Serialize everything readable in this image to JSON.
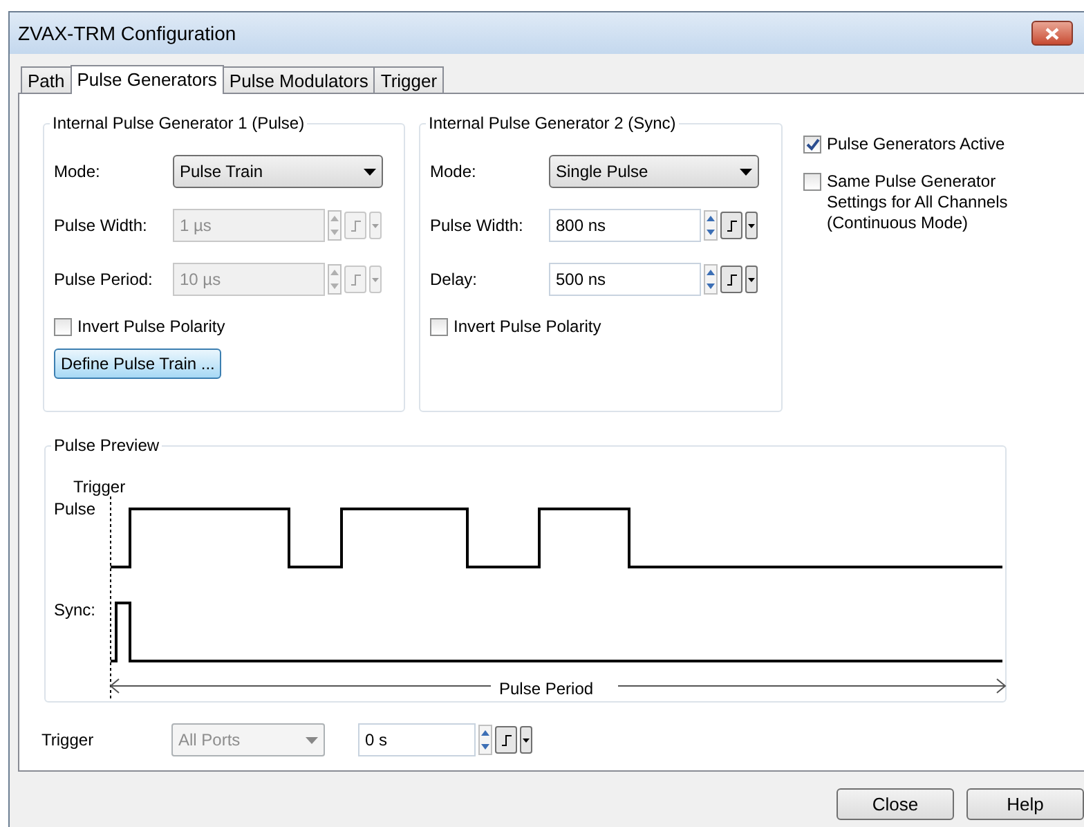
{
  "window": {
    "title": "ZVAX-TRM Configuration"
  },
  "tabs": [
    {
      "label": "Path",
      "selected": false
    },
    {
      "label": "Pulse Generators",
      "selected": true
    },
    {
      "label": "Pulse Modulators",
      "selected": false
    },
    {
      "label": "Trigger",
      "selected": false
    }
  ],
  "generators": [
    {
      "title": "Internal Pulse Generator 1 (Pulse)",
      "mode": {
        "label": "Mode:",
        "value": "Pulse Train"
      },
      "fields": [
        {
          "label": "Pulse Width:",
          "value": "1 µs",
          "disabled": true
        },
        {
          "label": "Pulse Period:",
          "value": "10 µs",
          "disabled": true
        }
      ],
      "invert": {
        "label": "Invert Pulse Polarity",
        "checked": false
      },
      "button": "Define Pulse Train ..."
    },
    {
      "title": "Internal Pulse Generator 2 (Sync)",
      "mode": {
        "label": "Mode:",
        "value": "Single Pulse"
      },
      "fields": [
        {
          "label": "Pulse Width:",
          "value": "800 ns",
          "disabled": false
        },
        {
          "label": "Delay:",
          "value": "500 ns",
          "disabled": false
        }
      ],
      "invert": {
        "label": "Invert Pulse Polarity",
        "checked": false
      }
    }
  ],
  "options": [
    {
      "label": "Pulse Generators Active",
      "checked": true
    },
    {
      "label": "Same Pulse Generator Settings for All Channels (Continuous Mode)",
      "checked": false
    }
  ],
  "preview": {
    "title": "Pulse Preview",
    "trigger_label": "Trigger",
    "pulse_label": "Pulse",
    "sync_label": "Sync:",
    "period_label": "Pulse Period"
  },
  "trigger": {
    "label": "Trigger",
    "source": {
      "value": "All Ports",
      "disabled": true
    },
    "delay": {
      "value": "0 s",
      "disabled": false
    }
  },
  "buttons": [
    "Close",
    "Help"
  ]
}
